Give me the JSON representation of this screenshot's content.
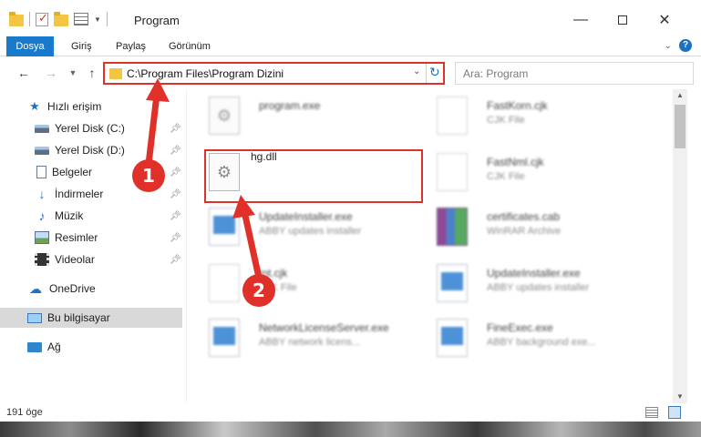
{
  "window": {
    "title": "Program"
  },
  "ribbon": {
    "tabs": [
      "Dosya",
      "Giriş",
      "Paylaş",
      "Görünüm"
    ]
  },
  "address": {
    "path": "C:\\Program Files\\Program Dizini"
  },
  "search": {
    "placeholder": "Ara: Program"
  },
  "sidebar": {
    "items": [
      {
        "label": "Hızlı erişim",
        "icon": "star-icon"
      },
      {
        "label": "Yerel Disk (C:)",
        "icon": "disk-icon",
        "pinned": true
      },
      {
        "label": "Yerel Disk (D:)",
        "icon": "disk-icon",
        "pinned": true
      },
      {
        "label": "Belgeler",
        "icon": "documents-icon",
        "pinned": true
      },
      {
        "label": "İndirmeler",
        "icon": "download-icon",
        "pinned": true
      },
      {
        "label": "Müzik",
        "icon": "music-icon",
        "pinned": true
      },
      {
        "label": "Resimler",
        "icon": "pictures-icon",
        "pinned": true
      },
      {
        "label": "Videolar",
        "icon": "videos-icon",
        "pinned": true
      },
      {
        "label": "OneDrive",
        "icon": "cloud-icon"
      },
      {
        "label": "Bu bilgisayar",
        "icon": "computer-icon",
        "selected": true
      },
      {
        "label": "Ağ",
        "icon": "network-icon"
      }
    ]
  },
  "files": [
    {
      "name": "program.exe",
      "type": ""
    },
    {
      "name": "FastKorn.cjk",
      "type": "CJK File"
    },
    {
      "name": "hg.dll",
      "type": ""
    },
    {
      "name": "FastNml.cjk",
      "type": "CJK File"
    },
    {
      "name": "UpdateInstaller.exe",
      "type": "ABBY updates installer"
    },
    {
      "name": "certificates.cab",
      "type": "WinRAR Archive"
    },
    {
      "name": "Int.cjk",
      "type": "CJK File"
    },
    {
      "name": "UpdateInstaller.exe",
      "type": "ABBY updates installer"
    },
    {
      "name": "NetworkLicenseServer.exe",
      "type": "ABBY network licens..."
    },
    {
      "name": "FineExec.exe",
      "type": "ABBY background exe..."
    }
  ],
  "status": {
    "count": "191 öge"
  },
  "annotations": {
    "step1": "1",
    "step2": "2"
  },
  "colors": {
    "accent": "#1979ca",
    "highlight": "#e0302a"
  }
}
